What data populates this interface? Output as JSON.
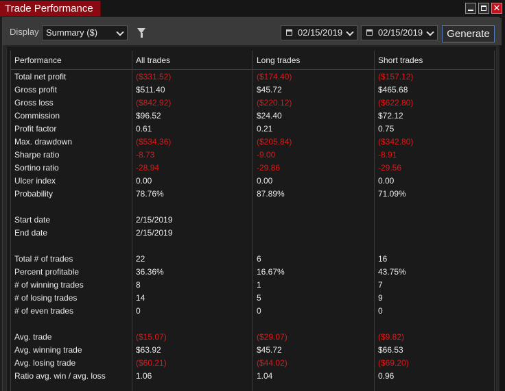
{
  "window": {
    "title": "Trade Performance"
  },
  "toolbar": {
    "display_label": "Display",
    "display_value": "Summary ($)",
    "start_date": "02/15/2019",
    "end_date": "02/15/2019",
    "generate_label": "Generate"
  },
  "table": {
    "headers": [
      "Performance",
      "All trades",
      "Long trades",
      "Short trades"
    ],
    "rows": [
      {
        "label": "Total net profit",
        "all": "($331.52)",
        "long": "($174.40)",
        "short": "($157.12)",
        "neg": [
          true,
          true,
          true
        ]
      },
      {
        "label": "Gross profit",
        "all": "$511.40",
        "long": "$45.72",
        "short": "$465.68",
        "neg": [
          false,
          false,
          false
        ]
      },
      {
        "label": "Gross loss",
        "all": "($842.92)",
        "long": "($220.12)",
        "short": "($622.80)",
        "neg": [
          true,
          true,
          true
        ]
      },
      {
        "label": "Commission",
        "all": "$96.52",
        "long": "$24.40",
        "short": "$72.12",
        "neg": [
          false,
          false,
          false
        ]
      },
      {
        "label": "Profit factor",
        "all": "0.61",
        "long": "0.21",
        "short": "0.75",
        "neg": [
          false,
          false,
          false
        ]
      },
      {
        "label": "Max. drawdown",
        "all": "($534.36)",
        "long": "($205.84)",
        "short": "($342.80)",
        "neg": [
          true,
          true,
          true
        ]
      },
      {
        "label": "Sharpe ratio",
        "all": "-8.73",
        "long": "-9.00",
        "short": "-8.91",
        "neg": [
          true,
          true,
          true
        ]
      },
      {
        "label": "Sortino ratio",
        "all": "-28.94",
        "long": "-29.86",
        "short": "-29.56",
        "neg": [
          true,
          true,
          true
        ]
      },
      {
        "label": "Ulcer index",
        "all": "0.00",
        "long": "0.00",
        "short": "0.00",
        "neg": [
          false,
          false,
          false
        ]
      },
      {
        "label": "Probability",
        "all": "78.76%",
        "long": "87.89%",
        "short": "71.09%",
        "neg": [
          false,
          false,
          false
        ]
      },
      {
        "label": "",
        "all": "",
        "long": "",
        "short": "",
        "neg": [
          false,
          false,
          false
        ]
      },
      {
        "label": "Start date",
        "all": "2/15/2019",
        "long": "",
        "short": "",
        "neg": [
          false,
          false,
          false
        ]
      },
      {
        "label": "End date",
        "all": "2/15/2019",
        "long": "",
        "short": "",
        "neg": [
          false,
          false,
          false
        ]
      },
      {
        "label": "",
        "all": "",
        "long": "",
        "short": "",
        "neg": [
          false,
          false,
          false
        ]
      },
      {
        "label": "Total # of trades",
        "all": "22",
        "long": "6",
        "short": "16",
        "neg": [
          false,
          false,
          false
        ]
      },
      {
        "label": "Percent profitable",
        "all": "36.36%",
        "long": "16.67%",
        "short": "43.75%",
        "neg": [
          false,
          false,
          false
        ]
      },
      {
        "label": "# of winning trades",
        "all": "8",
        "long": "1",
        "short": "7",
        "neg": [
          false,
          false,
          false
        ]
      },
      {
        "label": "# of losing trades",
        "all": "14",
        "long": "5",
        "short": "9",
        "neg": [
          false,
          false,
          false
        ]
      },
      {
        "label": "# of even trades",
        "all": "0",
        "long": "0",
        "short": "0",
        "neg": [
          false,
          false,
          false
        ]
      },
      {
        "label": "",
        "all": "",
        "long": "",
        "short": "",
        "neg": [
          false,
          false,
          false
        ]
      },
      {
        "label": "Avg. trade",
        "all": "($15.07)",
        "long": "($29.07)",
        "short": "($9.82)",
        "neg": [
          true,
          true,
          true
        ]
      },
      {
        "label": "Avg. winning trade",
        "all": "$63.92",
        "long": "$45.72",
        "short": "$66.53",
        "neg": [
          false,
          false,
          false
        ]
      },
      {
        "label": "Avg. losing trade",
        "all": "($60.21)",
        "long": "($44.02)",
        "short": "($69.20)",
        "neg": [
          true,
          true,
          true
        ]
      },
      {
        "label": "Ratio avg. win / avg. loss",
        "all": "1.06",
        "long": "1.04",
        "short": "0.96",
        "neg": [
          false,
          false,
          false
        ]
      }
    ]
  },
  "colors": {
    "negative": "#e01818",
    "accent_title": "#8b0a12",
    "generate_border": "#4f7dbd"
  },
  "icons": [
    "filter-icon",
    "calendar-icon",
    "minimize-icon",
    "maximize-icon",
    "close-icon",
    "chevron-down-icon"
  ]
}
